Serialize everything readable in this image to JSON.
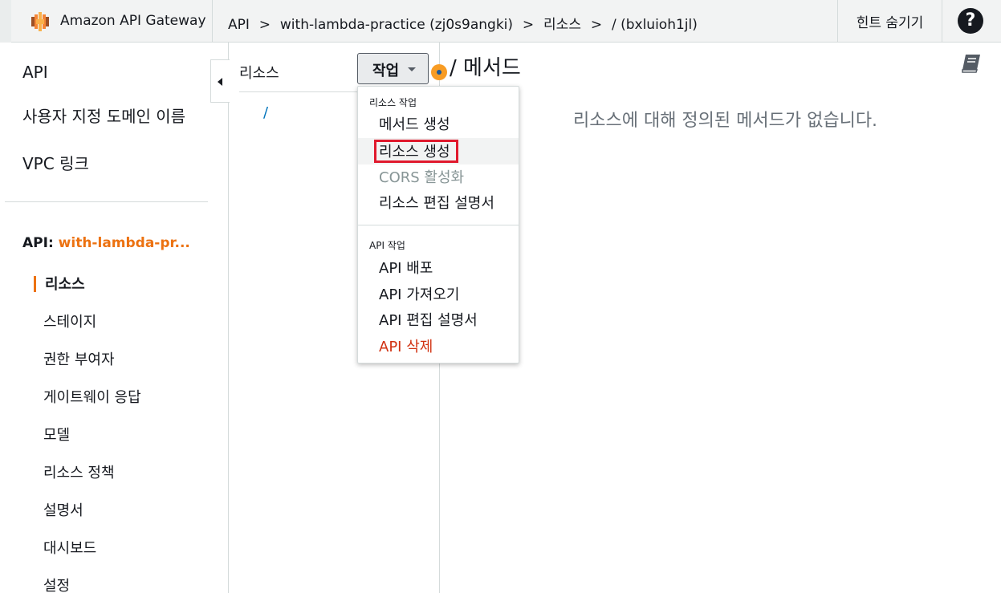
{
  "header": {
    "brand": "Amazon API Gateway",
    "breadcrumbs": [
      "API",
      "with-lambda-practice (zj0s9angki)",
      "리소스",
      "/ (bxluioh1jl)"
    ],
    "separator": ">",
    "hide_hints": "힌트 숨기기",
    "help": "?"
  },
  "sidebar": {
    "top_items": [
      "API",
      "사용자 지정 도메인 이름",
      "VPC 링크"
    ],
    "api_label": "API:",
    "api_name": "with-lambda-pr...",
    "sub_items": [
      "리소스",
      "스테이지",
      "권한 부여자",
      "게이트웨이 응답",
      "모델",
      "리소스 정책",
      "설명서",
      "대시보드",
      "설정"
    ],
    "active_item": "리소스"
  },
  "resources": {
    "header": "리소스",
    "tree": [
      "/"
    ]
  },
  "actions": {
    "button_label": "작업",
    "menu": {
      "resource_section": "리소스 작업",
      "resource_items": [
        "메서드 생성",
        "리소스 생성",
        "CORS 활성화",
        "리소스 편집 설명서"
      ],
      "api_section": "API 작업",
      "api_items": [
        "API 배포",
        "API 가져오기",
        "API 편집 설명서",
        "API 삭제"
      ],
      "highlighted_item": "리소스 생성",
      "disabled_item": "CORS 활성화",
      "danger_item": "API 삭제"
    }
  },
  "main": {
    "title": "/ 메서드",
    "empty_message": "리소스에 대해 정의된 메서드가 없습니다."
  },
  "colors": {
    "accent": "#ec7211",
    "danger": "#d13212",
    "highlight_box": "#e0192d",
    "link": "#0073bb"
  },
  "icons": {
    "brand": "api-gateway-logo-icon",
    "help": "help-icon",
    "collapse": "collapse-left-icon",
    "caret": "caret-down-icon",
    "status": "status-dot-icon",
    "book": "book-icon"
  }
}
